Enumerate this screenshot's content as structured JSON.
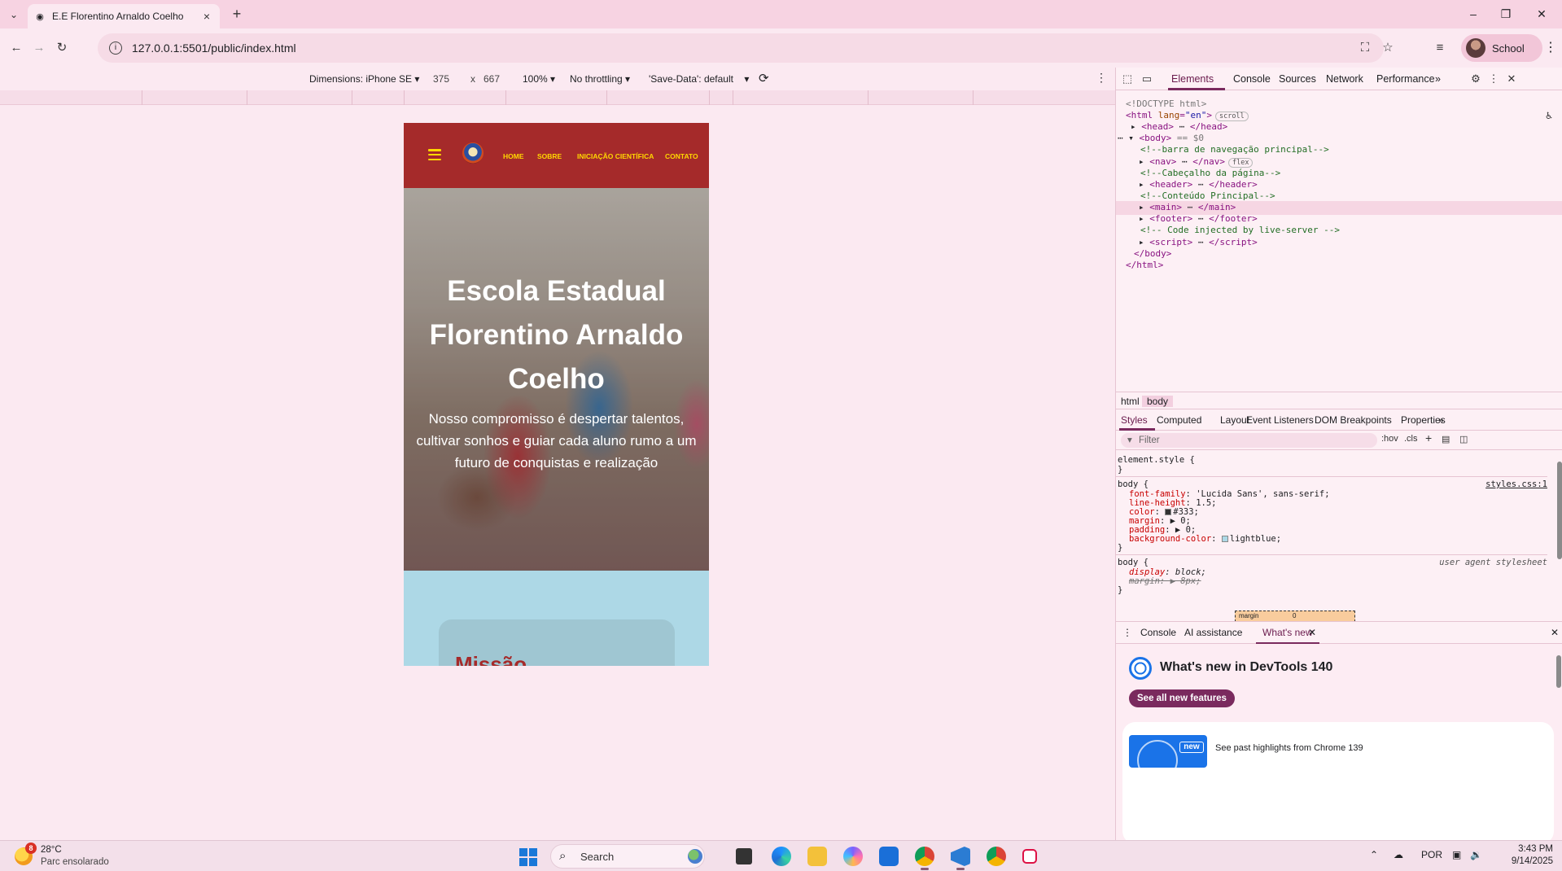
{
  "browser": {
    "tab_title": "E.E Florentino Arnaldo Coelho",
    "url": "127.0.0.1:5501/public/index.html",
    "profile_name": "School"
  },
  "device_toolbar": {
    "dimensions_label": "Dimensions: iPhone SE",
    "width": "375",
    "times": "x",
    "height": "667",
    "zoom": "100%",
    "throttling": "No throttling",
    "save_data": "'Save-Data': default"
  },
  "site": {
    "nav_links": [
      "HOME",
      "SOBRE",
      "INICIAÇÃO CIENTÍFICA",
      "CONTATO"
    ],
    "hero_title": "Escola Estadual Florentino Arnaldo Coelho",
    "hero_text": "Nosso compromisso é despertar talentos, cultivar sonhos e guiar cada aluno rumo a um futuro de conquistas e realização",
    "mission_title": "Missão",
    "colors": {
      "nav_bg": "#a52a2a",
      "nav_link": "#ffd700",
      "page_bg": "lightblue"
    }
  },
  "devtools": {
    "tabs": [
      "Elements",
      "Console",
      "Sources",
      "Network",
      "Performance"
    ],
    "more_tabs": "»",
    "dom": {
      "doctype": "<!DOCTYPE html>",
      "html_open_tag": "html",
      "html_attr": "lang",
      "html_attr_value": "\"en\"",
      "html_badge": "scroll",
      "head": "head",
      "body_marker": "== $0",
      "comment_nav": "<!--barra de navegação principal-->",
      "nav": "nav",
      "nav_badge": "flex",
      "comment_header": "<!--Cabeçalho da página-->",
      "header": "header",
      "comment_main": "<!--Conteúdo Principal-->",
      "main": "main",
      "footer": "footer",
      "comment_script": "<!-- Code injected by live-server -->",
      "script": "script",
      "ellipsis": "⋯"
    },
    "breadcrumbs": [
      "html",
      "body"
    ],
    "sub_tabs": [
      "Styles",
      "Computed",
      "Layout",
      "Event Listeners",
      "DOM Breakpoints",
      "Properties"
    ],
    "filter_placeholder": "Filter",
    "filter_tools": [
      ":hov",
      ".cls",
      "+"
    ],
    "styles": {
      "element_style": "element.style {",
      "close": "}",
      "body_selector": "body {",
      "body_source": "styles.css:1",
      "body_props": [
        {
          "name": "font-family",
          "value": "'Lucida Sans', sans-serif;"
        },
        {
          "name": "line-height",
          "value": "1.5;"
        },
        {
          "name": "color",
          "value": "#333;"
        },
        {
          "name": "margin",
          "value": "▶ 0;"
        },
        {
          "name": "padding",
          "value": "▶ 0;"
        },
        {
          "name": "background-color",
          "value": "lightblue;"
        }
      ],
      "ua_selector": "body {",
      "ua_source": "user agent stylesheet",
      "ua_display_name": "display",
      "ua_display_value": "block;",
      "ua_margin": "margin: ▶ 8px;"
    },
    "box_model": {
      "label": "margin",
      "value": "0"
    },
    "drawer_tabs": [
      "Console",
      "AI assistance",
      "What's new"
    ],
    "whats_new": {
      "title": "What's new in DevTools 140",
      "button": "See all new features",
      "badge": "new",
      "past_highlights": "See past highlights from Chrome 139"
    }
  },
  "taskbar": {
    "weather_badge": "8",
    "temperature": "28°C",
    "weather_desc": "Parc ensolarado",
    "search_label": "Search",
    "language": "POR",
    "time": "3:43 PM",
    "date": "9/14/2025"
  }
}
